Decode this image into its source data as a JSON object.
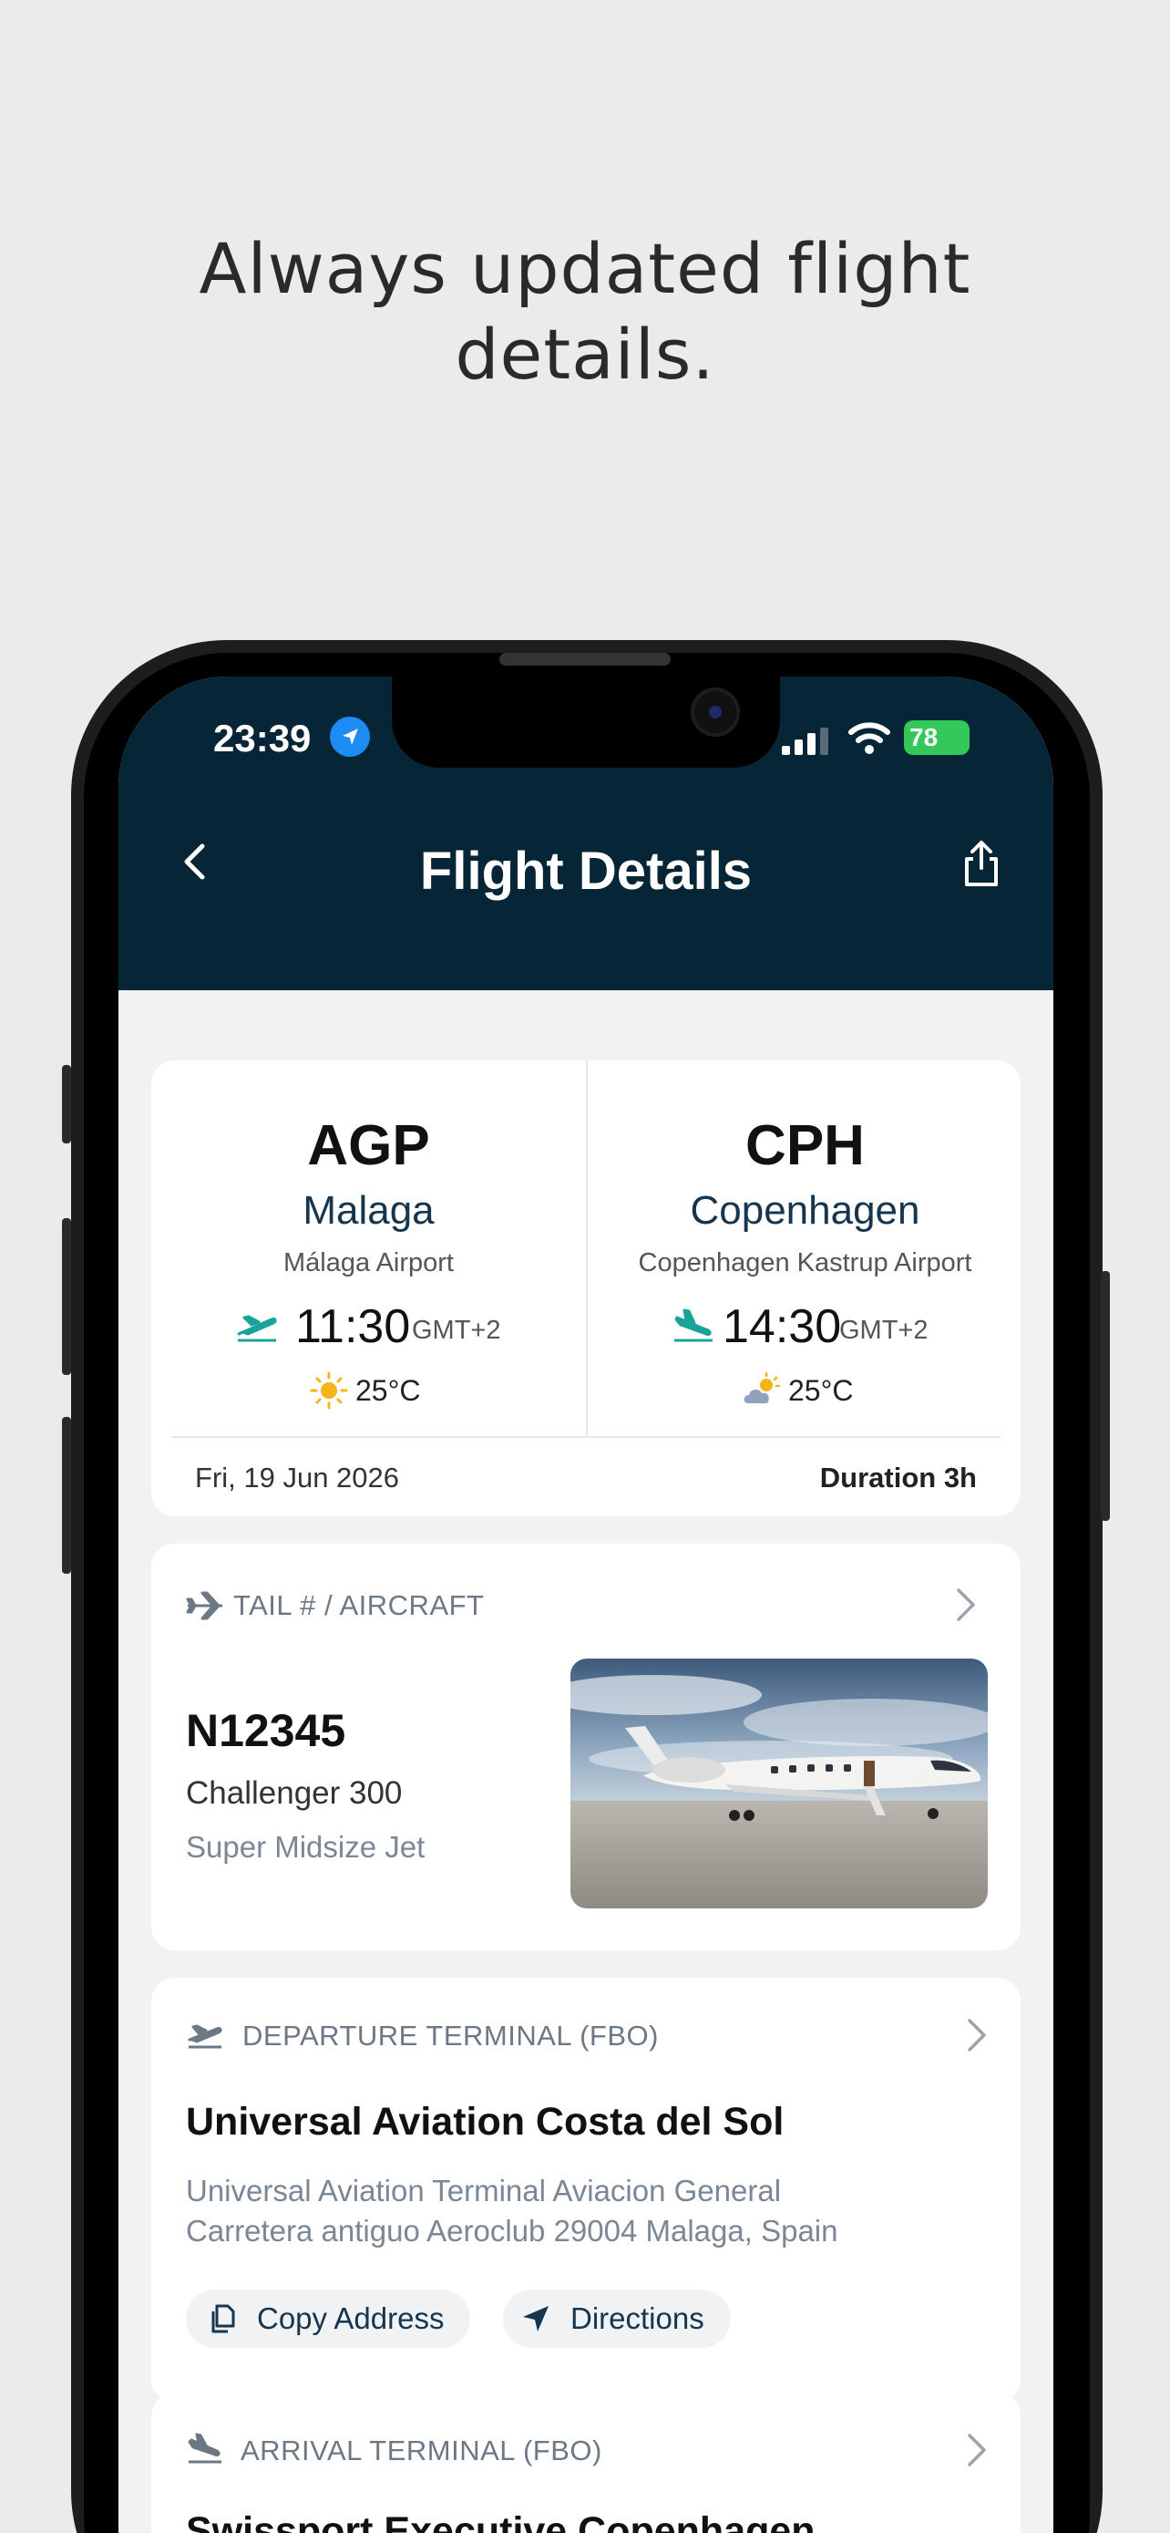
{
  "headline": {
    "line1": "Always updated flight",
    "line2": "details."
  },
  "status_bar": {
    "time": "23:39",
    "battery": "78"
  },
  "appbar": {
    "title": "Flight Details"
  },
  "route": {
    "departure": {
      "code": "AGP",
      "city": "Malaga",
      "airport": "Málaga Airport",
      "time": "11:30",
      "timezone": "GMT+2",
      "temperature": "25°C",
      "weather_icon": "sun-icon"
    },
    "arrival": {
      "code": "CPH",
      "city": "Copenhagen",
      "airport": "Copenhagen Kastrup Airport",
      "time": "14:30",
      "timezone": "GMT+2",
      "temperature": "25°C",
      "weather_icon": "partly-cloudy-icon"
    },
    "date": "Fri, 19 Jun 2026",
    "duration": "Duration 3h"
  },
  "aircraft": {
    "label": "TAIL # / AIRCRAFT",
    "tail": "N12345",
    "model": "Challenger 300",
    "category": "Super Midsize Jet"
  },
  "departure_terminal": {
    "label": "DEPARTURE TERMINAL (FBO)",
    "name": "Universal Aviation Costa del Sol",
    "address_line1": "Universal Aviation Terminal Aviacion General",
    "address_line2": "Carretera antiguo Aeroclub 29004 Malaga, Spain",
    "copy_label": "Copy Address",
    "directions_label": "Directions"
  },
  "arrival_terminal": {
    "label": "ARRIVAL TERMINAL (FBO)",
    "name": "Swissport Executive Copenhagen"
  },
  "colors": {
    "appbar": "#062637",
    "accent_teal": "#1aa39a",
    "battery": "#34c759",
    "location_badge": "#1e8cf5"
  }
}
